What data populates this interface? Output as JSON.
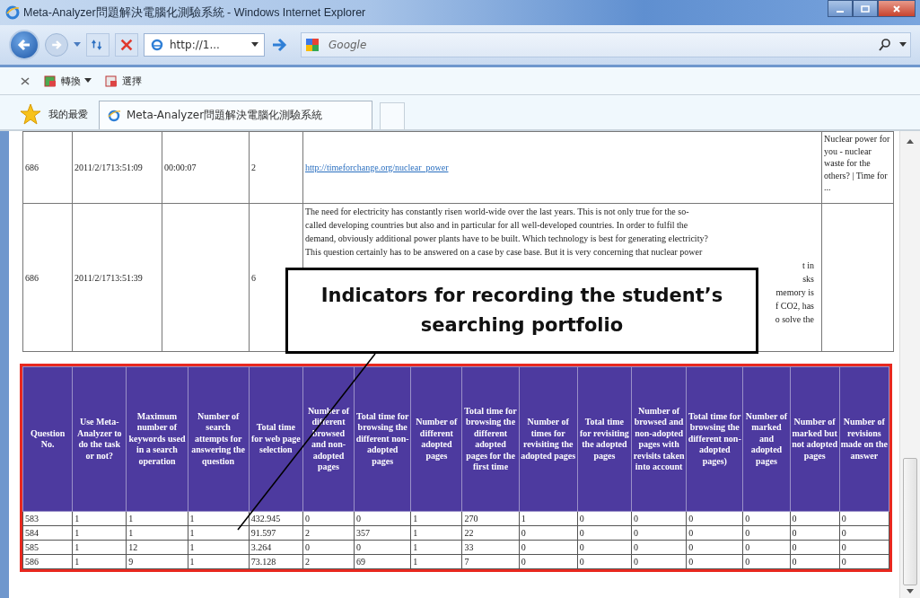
{
  "window": {
    "title": "Meta-Analyzer問題解決電腦化測驗系統 - Windows Internet Explorer"
  },
  "address_bar": {
    "value": "http://1..."
  },
  "search": {
    "placeholder": "Google"
  },
  "command_bar": [
    {
      "label": "轉換",
      "dropdown": true
    },
    {
      "label": "選擇",
      "dropdown": false
    }
  ],
  "favorites": {
    "label": "我的最愛"
  },
  "tabs": [
    {
      "label": "Meta-Analyzer問題解決電腦化測驗系統",
      "selected": true
    }
  ],
  "log_table": {
    "rows": [
      {
        "question": "686",
        "time": "2011/2/1713:51:09",
        "duration": "00:00:07",
        "count": "2",
        "content": {
          "kind": "link",
          "text": "http://timeforchange.org/nuclear_power"
        },
        "title": "Nuclear power for you - nuclear waste for the others? | Time for ..."
      },
      {
        "question": "686",
        "time": "2011/2/1713:51:39",
        "count": "6",
        "content": {
          "kind": "text",
          "lines": [
            "The need for electricity has constantly risen world-wide over the last years. This is not only true for the so-",
            "called developing countries but also and in particular for all well-developed countries. In order to fulfil the",
            "demand, obviously additional power plants have to be built. Which technology is best for generating electricity?",
            "This question certainly has to be answered on a case by case base. But it is very concerning that nuclear power"
          ],
          "fragments": [
            "t in",
            "sks",
            "memory is",
            "f CO2, has",
            "o solve the"
          ]
        }
      }
    ]
  },
  "callout": {
    "text": "Indicators for recording the student’s searching portfolio"
  },
  "indicator_table": {
    "columns": [
      "Question No.",
      "Use Meta-Analyzer to do the task or not?",
      "Maximum number of keywords used in a search operation",
      "Number of search attempts for answering the question",
      "Total time for web page selection",
      "Number of different browsed and non-adopted pages",
      "Total time for browsing the different non-adopted pages",
      "Number of different adopted pages",
      "Total time for browsing the different adopted pages for the first time",
      "Number of times for revisiting the adopted pages",
      "Total time for revisiting the adopted pages",
      "Number of browsed and non-adopted pages with revisits taken into account",
      "Total time for browsing the different non-adopted pages)",
      "Number of marked and adopted pages",
      "Number of marked but not adopted pages",
      "Number of revisions made on the answer"
    ],
    "rows": [
      [
        "583",
        "1",
        "1",
        "1",
        "432.945",
        "0",
        "0",
        "1",
        "270",
        "1",
        "0",
        "0",
        "0",
        "0",
        "0",
        "0"
      ],
      [
        "584",
        "1",
        "1",
        "1",
        "91.597",
        "2",
        "357",
        "1",
        "22",
        "0",
        "0",
        "0",
        "0",
        "0",
        "0",
        "0"
      ],
      [
        "585",
        "1",
        "12",
        "1",
        "3.264",
        "0",
        "0",
        "1",
        "33",
        "0",
        "0",
        "0",
        "0",
        "0",
        "0",
        "0"
      ],
      [
        "586",
        "1",
        "9",
        "1",
        "73.128",
        "2",
        "69",
        "1",
        "7",
        "0",
        "0",
        "0",
        "0",
        "0",
        "0",
        "0"
      ]
    ]
  }
}
